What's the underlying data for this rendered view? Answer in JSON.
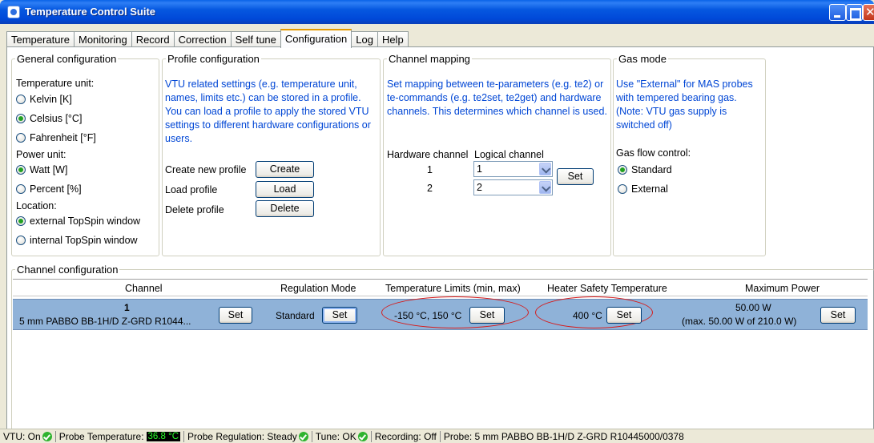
{
  "window": {
    "title": "Temperature Control Suite"
  },
  "tabs": [
    {
      "label": "Temperature"
    },
    {
      "label": "Monitoring"
    },
    {
      "label": "Record"
    },
    {
      "label": "Correction"
    },
    {
      "label": "Self tune"
    },
    {
      "label": "Configuration",
      "active": true
    },
    {
      "label": "Log"
    },
    {
      "label": "Help"
    }
  ],
  "general": {
    "title": "General configuration",
    "temp_unit_label": "Temperature unit:",
    "temp_units": [
      "Kelvin [K]",
      "Celsius [°C]",
      "Fahrenheit [°F]"
    ],
    "temp_unit_selected": "Celsius [°C]",
    "power_unit_label": "Power unit:",
    "power_units": [
      "Watt [W]",
      "Percent [%]"
    ],
    "power_unit_selected": "Watt [W]",
    "location_label": "Location:",
    "locations": [
      "external TopSpin window",
      "internal TopSpin window"
    ],
    "location_selected": "external TopSpin window"
  },
  "profile": {
    "title": "Profile configuration",
    "description": "VTU related settings (e.g. temperature unit, names, limits etc.) can be stored in a profile. You can load a profile to apply the stored VTU settings to different hardware configurations or users.",
    "create_label": "Create new profile",
    "create_button": "Create",
    "load_label": "Load profile",
    "load_button": "Load",
    "delete_label": "Delete profile",
    "delete_button": "Delete"
  },
  "mapping": {
    "title": "Channel mapping",
    "description": "Set mapping between te-parameters (e.g. te2) or te-commands (e.g. te2set, te2get) and hardware channels. This determines which channel is used.",
    "hw_header": "Hardware channel",
    "logical_header": "Logical channel",
    "rows": [
      {
        "hw": "1",
        "logical": "1"
      },
      {
        "hw": "2",
        "logical": "2"
      }
    ],
    "set_button": "Set"
  },
  "gas": {
    "title": "Gas mode",
    "description": "Use \"External\" for MAS probes with tempered bearing gas. (Note: VTU gas supply is switched off)",
    "flow_label": "Gas flow control:",
    "options": [
      "Standard",
      "External"
    ],
    "selected": "Standard"
  },
  "channel_config": {
    "title": "Channel configuration",
    "headers": {
      "channel": "Channel",
      "regulation": "Regulation Mode",
      "limits": "Temperature Limits (min, max)",
      "safety": "Heater Safety Temperature",
      "power": "Maximum Power"
    },
    "row": {
      "number": "1",
      "probe": "5 mm PABBO BB-1H/D Z-GRD R1044...",
      "regulation": "Standard",
      "limits": "-150 °C, 150 °C",
      "safety": "400 °C",
      "power": "50.00 W",
      "power_detail": "(max. 50.00 W of 210.0 W)",
      "set_label": "Set"
    }
  },
  "status": {
    "vtu": "VTU: On",
    "probe_temp_label": "Probe Temperature:",
    "probe_temp_value": "36.8 °C",
    "regulation": "Probe Regulation: Steady",
    "tune": "Tune: OK",
    "recording": "Recording: Off",
    "probe": "Probe: 5 mm PABBO BB-1H/D Z-GRD R10445000/0378"
  },
  "colors": {
    "titlebar": "#0058e0",
    "selected_row": "#8fb2d8",
    "highlight_oval": "#d61a1a",
    "link_text": "#0046d5"
  }
}
